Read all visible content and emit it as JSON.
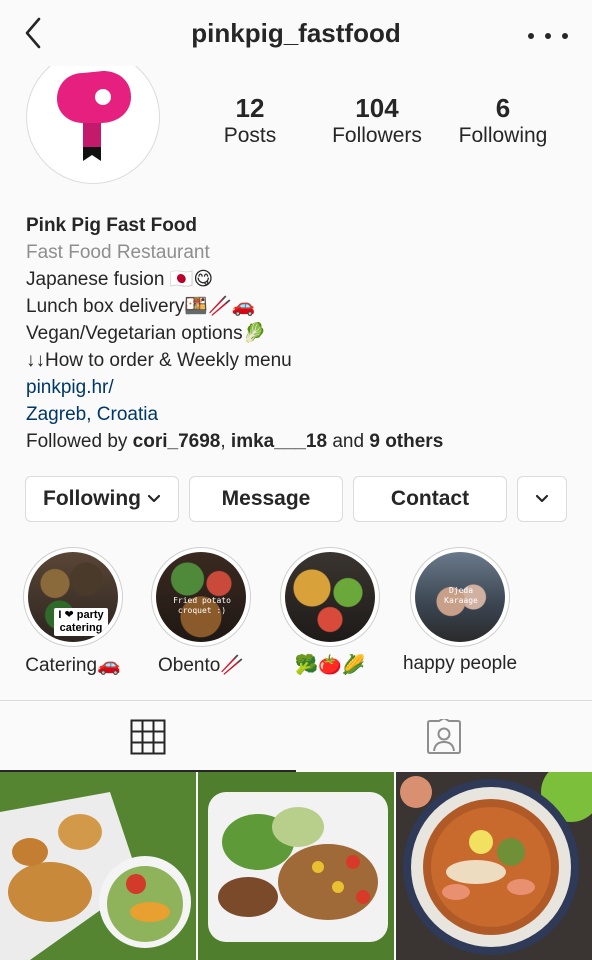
{
  "header": {
    "username": "pinkpig_fastfood"
  },
  "stats": [
    {
      "value": "12",
      "label": "Posts"
    },
    {
      "value": "104",
      "label": "Followers"
    },
    {
      "value": "6",
      "label": "Following"
    }
  ],
  "bio": {
    "name": "Pink Pig Fast Food",
    "category": "Fast Food Restaurant",
    "line1": "Japanese fusion 🇯🇵😋",
    "line2": "Lunch box delivery🍱🥢🚗",
    "line3": "Vegan/Vegetarian options🥬",
    "line4": "↓↓How to order & Weekly menu",
    "website": "pinkpig.hr/",
    "location_city": "Zagreb",
    "location_comma": ", ",
    "location_country": "Croatia",
    "followed_prefix": "Followed by ",
    "followed_user1": "cori_7698",
    "followed_sep": ", ",
    "followed_user2": "imka___18",
    "followed_and": " and ",
    "followed_others": "9 others"
  },
  "buttons": {
    "following": "Following",
    "message": "Message",
    "contact": "Contact"
  },
  "highlights": [
    {
      "label": "Catering🚗",
      "overlay": "I ❤ party catering"
    },
    {
      "label": "Obento🥢",
      "overlay": "Fried potato croquet :)"
    },
    {
      "label": "🥦🍅🌽",
      "overlay": ""
    },
    {
      "label": "happy people",
      "overlay": "Djeda Karaage"
    }
  ],
  "icons": {
    "back": "chevron-left-icon",
    "more": "more-dots-icon",
    "grid": "grid-icon",
    "tagged": "tagged-person-icon",
    "dropdown": "chevron-down-icon"
  },
  "colors": {
    "brand_pink": "#e6207e",
    "link": "#00376b",
    "muted": "#8e8e8e",
    "border": "#dbdbdb"
  }
}
